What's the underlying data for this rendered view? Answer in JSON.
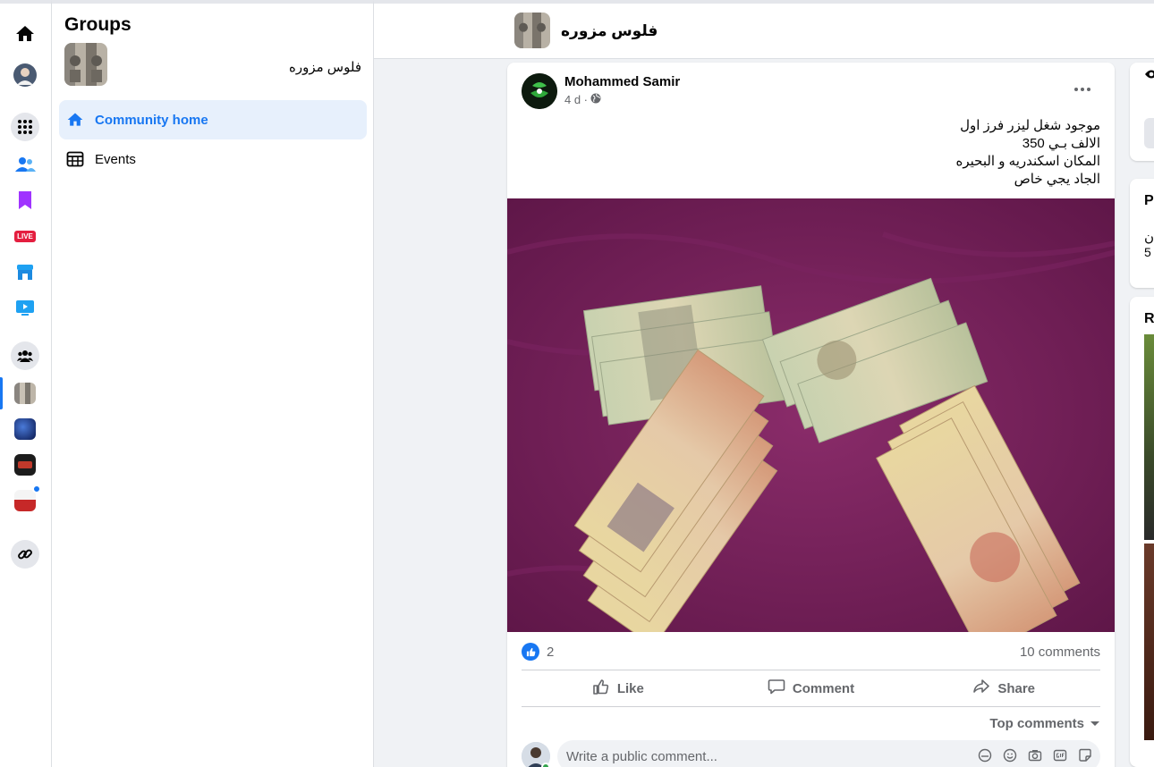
{
  "rail": {
    "icons": [
      "home-icon",
      "profile-avatar",
      "menu-grid-icon",
      "friends-icon",
      "saved-icon",
      "live-icon",
      "marketplace-icon",
      "watch-icon",
      "groups-icon",
      "group-shortcut",
      "group-shortcut",
      "group-shortcut",
      "group-shortcut",
      "link-icon"
    ],
    "live_label": "LIVE"
  },
  "sidebar": {
    "title": "Groups",
    "group_name": "فلوس مزوره",
    "nav": [
      {
        "label": "Community home",
        "icon": "home-icon",
        "active": true
      },
      {
        "label": "Events",
        "icon": "calendar-grid-icon",
        "active": false
      }
    ]
  },
  "header": {
    "group_name": "فلوس مزوره"
  },
  "post": {
    "author": "Mohammed Samir",
    "time": "4 d ·",
    "privacy_icon": "globe-icon",
    "lines": [
      "موجود شغل ليزر فرز اول",
      "الالف بـي 350",
      "المكان اسكندريه و البحيره",
      "الجاد يجي خاص"
    ],
    "image_alt": "banknotes-photo",
    "reaction_count": "2",
    "comments_count": "10 comments",
    "actions": {
      "like": "Like",
      "comment": "Comment",
      "share": "Share"
    },
    "top_comments_label": "Top comments",
    "comment_placeholder": "Write a public comment..."
  },
  "right_column": {
    "card2_heading": "Pe",
    "card2_line1": "ن",
    "card2_line2": "5",
    "card3_heading": "Re"
  },
  "colors": {
    "accent": "#1877f2",
    "page_bg": "#f0f2f5",
    "online": "#31a24c",
    "live_red": "#e41e3f"
  }
}
